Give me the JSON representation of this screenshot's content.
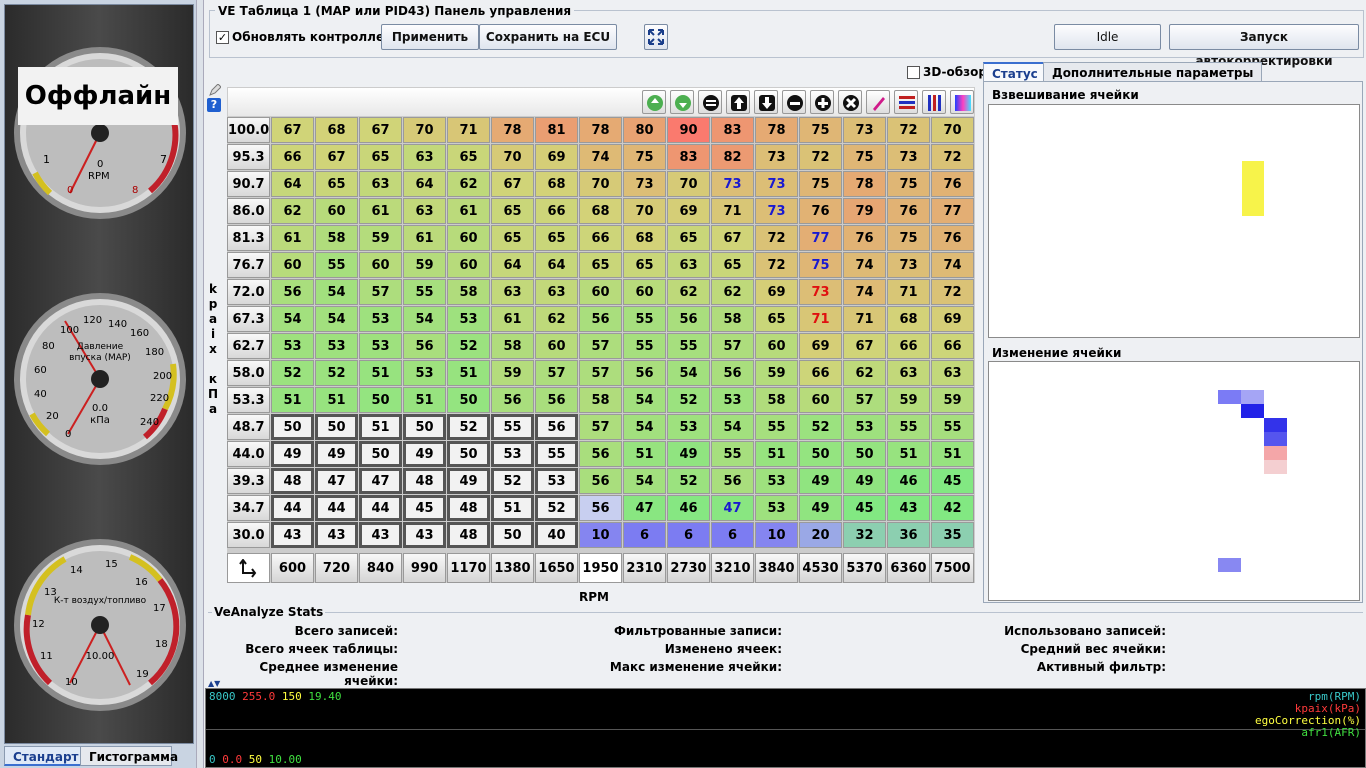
{
  "left": {
    "offline_label": "Оффлайн",
    "rpm_gauge": {
      "title": "RPM",
      "value": "0",
      "ticks": [
        "1",
        "7",
        "0",
        "8"
      ]
    },
    "map_gauge": {
      "title": "Давление впуска (MAP)",
      "value": "0.0",
      "unit": "кПа",
      "ticks": [
        "0",
        "20",
        "40",
        "60",
        "80",
        "100",
        "120",
        "140",
        "160",
        "180",
        "200",
        "220",
        "240"
      ]
    },
    "afr_gauge": {
      "title": "К-т воздух/топливо",
      "value": "10.00",
      "ticks": [
        "10",
        "11",
        "12",
        "13",
        "14",
        "15",
        "16",
        "17",
        "18",
        "19"
      ]
    },
    "tabs": [
      "Стандарт",
      "Гистограмма"
    ]
  },
  "header": {
    "title": "VE Таблица 1 (MAP или PID43) Панель управления",
    "update_checkbox_label": "Обновлять контроллер",
    "update_checked": true,
    "apply_label": "Применить",
    "save_label": "Сохранить на ECU",
    "idle_label": "Idle",
    "autotune_label": "Запуск автокорректировки",
    "view3d_label": "3D-обзор"
  },
  "table": {
    "y_axis_label": "kpaix кПа",
    "x_axis_label": "RPM",
    "y_values": [
      "100.0",
      "95.3",
      "90.7",
      "86.0",
      "81.3",
      "76.7",
      "72.0",
      "67.3",
      "62.7",
      "58.0",
      "53.3",
      "48.7",
      "44.0",
      "39.3",
      "34.7",
      "30.0"
    ],
    "x_values": [
      "600",
      "720",
      "840",
      "990",
      "1170",
      "1380",
      "1650",
      "1950",
      "2310",
      "2730",
      "3210",
      "3840",
      "4530",
      "5370",
      "6360",
      "7500"
    ],
    "rows": [
      [
        67,
        68,
        67,
        70,
        71,
        78,
        81,
        78,
        80,
        90,
        83,
        78,
        75,
        73,
        72,
        70
      ],
      [
        66,
        67,
        65,
        63,
        65,
        70,
        69,
        74,
        75,
        83,
        82,
        73,
        72,
        75,
        73,
        72
      ],
      [
        64,
        65,
        63,
        64,
        62,
        67,
        68,
        70,
        73,
        70,
        73,
        73,
        75,
        78,
        75,
        76
      ],
      [
        62,
        60,
        61,
        63,
        61,
        65,
        66,
        68,
        70,
        69,
        71,
        73,
        76,
        79,
        76,
        77
      ],
      [
        61,
        58,
        59,
        61,
        60,
        65,
        65,
        66,
        68,
        65,
        67,
        72,
        77,
        76,
        75,
        76
      ],
      [
        60,
        55,
        60,
        59,
        60,
        64,
        64,
        65,
        65,
        63,
        65,
        72,
        75,
        74,
        73,
        74
      ],
      [
        56,
        54,
        57,
        55,
        58,
        63,
        63,
        60,
        60,
        62,
        62,
        69,
        73,
        74,
        71,
        72
      ],
      [
        54,
        54,
        53,
        54,
        53,
        61,
        62,
        56,
        55,
        56,
        58,
        65,
        71,
        71,
        68,
        69
      ],
      [
        53,
        53,
        53,
        56,
        52,
        58,
        60,
        57,
        55,
        55,
        57,
        60,
        69,
        67,
        66,
        66
      ],
      [
        52,
        52,
        51,
        53,
        51,
        59,
        57,
        57,
        56,
        54,
        56,
        59,
        66,
        62,
        63,
        63
      ],
      [
        51,
        51,
        50,
        51,
        50,
        56,
        56,
        58,
        54,
        52,
        53,
        58,
        60,
        57,
        59,
        59
      ],
      [
        50,
        50,
        51,
        50,
        52,
        55,
        56,
        57,
        54,
        53,
        54,
        55,
        52,
        53,
        55,
        55
      ],
      [
        49,
        49,
        50,
        49,
        50,
        53,
        55,
        56,
        51,
        49,
        55,
        51,
        50,
        50,
        51,
        51
      ],
      [
        48,
        47,
        47,
        48,
        49,
        52,
        53,
        56,
        54,
        52,
        56,
        53,
        49,
        49,
        46,
        45
      ],
      [
        44,
        44,
        44,
        45,
        48,
        51,
        52,
        56,
        47,
        46,
        47,
        53,
        49,
        45,
        43,
        42
      ],
      [
        43,
        43,
        43,
        43,
        48,
        50,
        40,
        10,
        6,
        6,
        6,
        10,
        20,
        32,
        36,
        35
      ]
    ],
    "blue_text_cells": [
      [
        2,
        10
      ],
      [
        2,
        11
      ],
      [
        3,
        11
      ],
      [
        4,
        12
      ],
      [
        5,
        12
      ],
      [
        14,
        10
      ]
    ],
    "red_text_cells": [
      [
        6,
        12
      ],
      [
        7,
        12
      ]
    ],
    "selected_block": {
      "rows": [
        11,
        15
      ],
      "cols": [
        0,
        6
      ]
    }
  },
  "toolbar_icons": [
    "up-green-icon",
    "down-green-icon",
    "equals-icon",
    "up-arrow-icon",
    "down-arrow-icon",
    "minus-icon",
    "plus-icon",
    "multiply-icon",
    "pen-icon",
    "horizontal-interpolate-icon",
    "vertical-interpolate-icon",
    "color-gradient-icon"
  ],
  "right": {
    "tabs": [
      "Статус",
      "Дополнительные параметры"
    ],
    "weight_label": "Взвешивание ячейки",
    "change_label": "Изменение ячейки"
  },
  "stats": {
    "title": "VeAnalyze Stats",
    "col1": [
      "Всего записей:",
      "Всего ячеек таблицы:",
      "Среднее изменение ячейки:"
    ],
    "col2": [
      "Фильтрованные записи:",
      "Изменено ячеек:",
      "Макс изменение ячейки:"
    ],
    "col3": [
      "Использовано записей:",
      "Средний вес ячейки:",
      "Активный фильтр:"
    ]
  },
  "chart": {
    "top_values": [
      "8000",
      "255.0",
      "150",
      "19.40"
    ],
    "bottom_values": [
      "0",
      "0.0",
      "50",
      "10.00"
    ],
    "legend": [
      "rpm(RPM)",
      "kpaix(kPa)",
      "egoCorrection(%)",
      "afr1(AFR)"
    ],
    "colors": [
      "#39c8c8",
      "#ff3a3a",
      "#ffff40",
      "#40e040"
    ]
  }
}
